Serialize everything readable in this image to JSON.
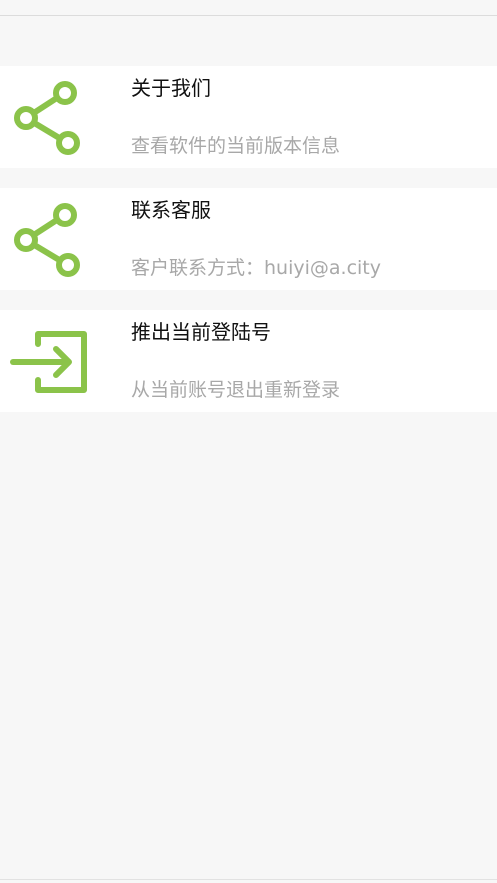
{
  "theme": {
    "accent": "#8bc34a",
    "background": "#f7f7f7",
    "card": "#ffffff",
    "title_color": "#111111",
    "subtitle_color": "#a8a8a8"
  },
  "menu": {
    "items": [
      {
        "icon": "share-icon",
        "title": "关于我们",
        "subtitle": "查看软件的当前版本信息"
      },
      {
        "icon": "share-icon",
        "title": "联系客服",
        "subtitle": "客户联系方式：huiyi@a.city"
      },
      {
        "icon": "logout-icon",
        "title": "推出当前登陆号",
        "subtitle": "从当前账号退出重新登录"
      }
    ]
  }
}
